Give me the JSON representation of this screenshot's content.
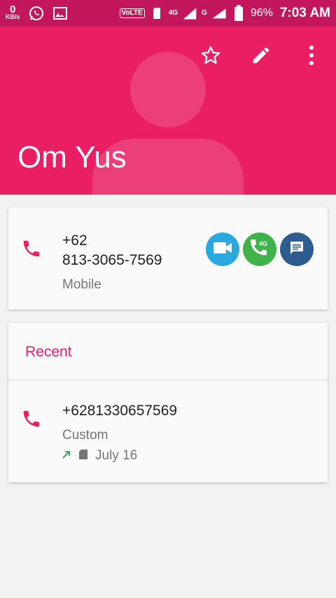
{
  "status_bar": {
    "speed_value": "0",
    "speed_unit": "KB/s",
    "volte": "VoLTE",
    "net1": "4G",
    "net2": "4G",
    "net3": "G",
    "battery": "96%",
    "time": "7:03 AM"
  },
  "contact": {
    "name": "Om Yus",
    "phone_line1": "+62",
    "phone_line2": "813-3065-7569",
    "phone_type": "Mobile",
    "video_call_icon": "video-camera-icon",
    "volte_call_icon": "phone-4g-icon",
    "message_icon": "message-icon",
    "video_color": "#29a9e0",
    "volte_color": "#3fb24a",
    "message_color": "#2f5c8f"
  },
  "header_actions": {
    "favorite_icon": "star-outline-icon",
    "edit_icon": "pencil-icon",
    "more_icon": "more-vert-icon"
  },
  "recent": {
    "title": "Recent",
    "number": "+6281330657569",
    "label": "Custom",
    "date": "July 16",
    "call_direction_icon": "outgoing-arrow-icon",
    "sim_icon": "sim-card-icon"
  },
  "colors": {
    "status_bar": "#c2185b",
    "header": "#e91e63",
    "accent": "#e91e63"
  }
}
